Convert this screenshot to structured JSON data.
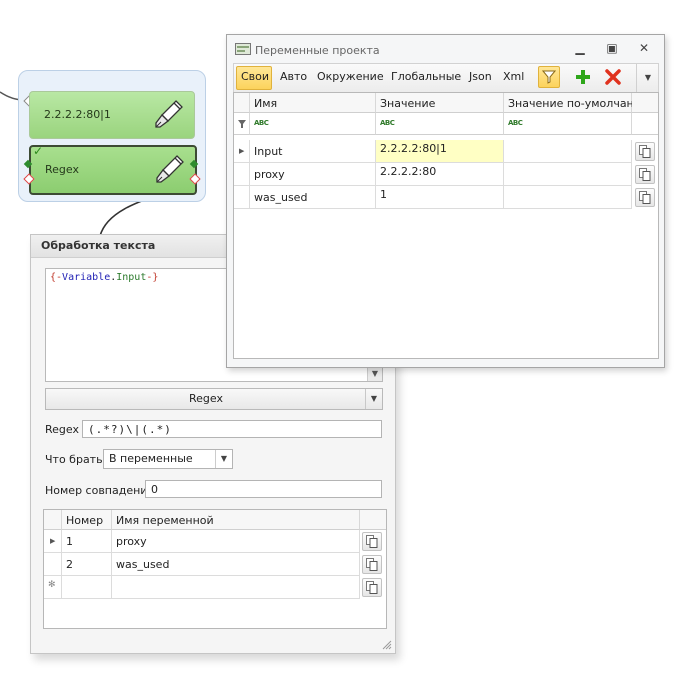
{
  "node_group": {
    "node1_label": "2.2.2.2:80|1",
    "node2_label": "Regex",
    "node2_check": "✓"
  },
  "text_panel": {
    "title": "Обработка текста",
    "code": {
      "open": "{-",
      "var_word": "Variable",
      "dot": ".",
      "var_name": "Input",
      "close": "-}"
    },
    "mode_dropdown": "Regex",
    "regex_label": "Regex",
    "regex_value": "(.*?)\\|(.*)",
    "take_label": "Что брать",
    "take_value": "В переменные",
    "match_label": "Номер совпадения",
    "match_value": "0",
    "grid": {
      "columns": [
        "Номер",
        "Имя переменной"
      ],
      "rows": [
        {
          "num": "1",
          "name": "proxy"
        },
        {
          "num": "2",
          "name": "was_used"
        }
      ],
      "new_row_marker": "✻"
    }
  },
  "vars_window": {
    "title": "Переменные проекта",
    "toolbar": {
      "tabs": [
        "Свои",
        "Авто",
        "Окружение",
        "Глобальные",
        "Json",
        "Xml"
      ],
      "active_tab": "Свои",
      "filter_icon": "filter-icon",
      "add_icon": "plus-icon",
      "delete_icon": "close-icon"
    },
    "grid": {
      "columns": [
        "Имя",
        "Значение",
        "Значение по-умолчан..."
      ],
      "filter_marker": "ABC",
      "rows": [
        {
          "name": "Input",
          "value": "2.2.2.2:80|1",
          "default": ""
        },
        {
          "name": "proxy",
          "value": "2.2.2.2:80",
          "default": ""
        },
        {
          "name": "was_used",
          "value": "1",
          "default": ""
        }
      ]
    }
  },
  "colors": {
    "accent_yellow": "#fcd35c",
    "node_green": "#9ad47e",
    "highlight_cell": "#ffffc4",
    "add_green": "#2ea61a",
    "delete_red": "#e0321e",
    "code_blue": "#1f1fb4",
    "code_green": "#2c7a2c",
    "code_red": "#c0392b"
  }
}
